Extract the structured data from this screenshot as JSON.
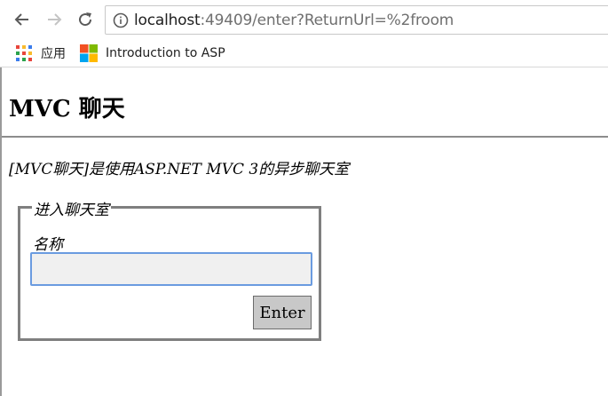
{
  "browser": {
    "url_host": "localhost",
    "url_rest": ":49409/enter?ReturnUrl=%2froom",
    "bookmarks": [
      {
        "label": "应用",
        "icon": "apps-grid-icon"
      },
      {
        "label": "Introduction to ASP",
        "icon": "microsoft-logo-icon"
      }
    ]
  },
  "page": {
    "title": "MVC 聊天",
    "description": "[MVC聊天]是使用ASP.NET MVC 3的异步聊天室",
    "form": {
      "legend": "进入聊天室",
      "name_label": "名称",
      "name_value": "",
      "submit_label": "Enter"
    }
  },
  "colors": {
    "input_focus_border": "#6a9be0",
    "fieldset_border": "#7f7f7f",
    "button_bg": "#c8c8c8"
  }
}
